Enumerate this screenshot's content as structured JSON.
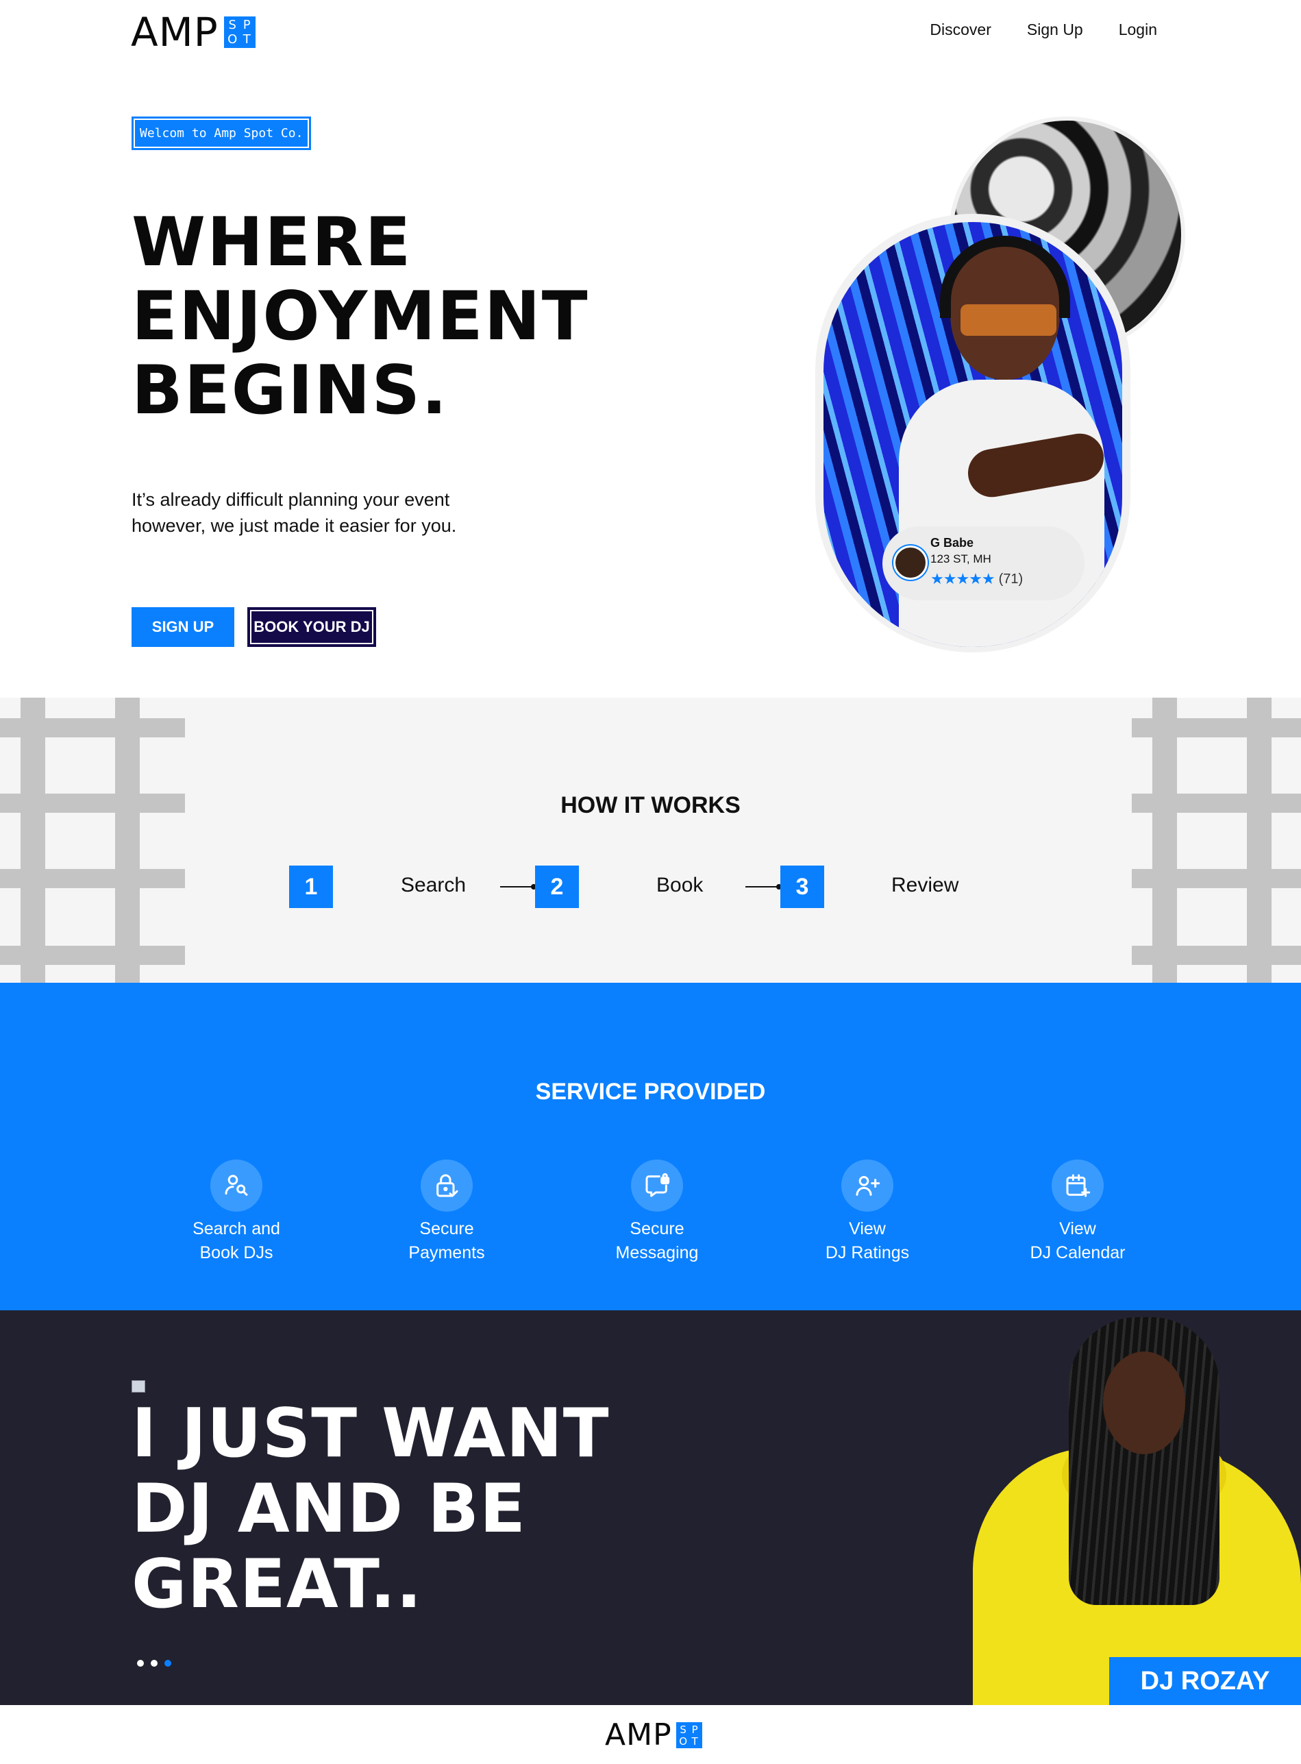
{
  "nav": {
    "logo": {
      "text": "AMP",
      "box": [
        "S",
        "P",
        "O",
        "T"
      ]
    },
    "links": [
      "Discover",
      "Sign Up",
      "Login"
    ]
  },
  "hero": {
    "badge": "Welcom to Amp Spot Co.",
    "title": [
      "WHERE",
      "ENJOYMENT",
      "BEGINS."
    ],
    "subtitle": "It’s already difficult planning your event however, we just made it easier for you.",
    "buttons": {
      "signup": "SIGN UP",
      "book": "BOOK YOUR DJ"
    },
    "profile": {
      "name": "G Babe",
      "location": "123 ST, MH",
      "stars": "★★★★★",
      "rating_count": "(71)",
      "rating": 5
    }
  },
  "how_it_works": {
    "title": "HOW IT WORKS",
    "steps": [
      {
        "num": "1",
        "label": "Search"
      },
      {
        "num": "2",
        "label": "Book"
      },
      {
        "num": "3",
        "label": "Review"
      }
    ]
  },
  "services": {
    "title": "SERVICE PROVIDED",
    "items": [
      {
        "line1": "Search and",
        "line2": "Book DJs",
        "icon": "user-search-icon"
      },
      {
        "line1": "Secure",
        "line2": "Payments",
        "icon": "lock-check-icon"
      },
      {
        "line1": "Secure",
        "line2": "Messaging",
        "icon": "message-lock-icon"
      },
      {
        "line1": "View",
        "line2": "DJ Ratings",
        "icon": "user-plus-icon"
      },
      {
        "line1": "View",
        "line2": "DJ Calendar",
        "icon": "calendar-plus-icon"
      }
    ]
  },
  "quote": {
    "title": [
      "I JUST WANT",
      "DJ AND BE",
      "GREAT.."
    ],
    "dj_name": "DJ ROZAY",
    "slide_count": 3,
    "active_slide": 3
  },
  "footer": {
    "logo": {
      "text": "AMP",
      "box": [
        "S",
        "P",
        "O",
        "T"
      ]
    }
  },
  "colors": {
    "accent": "#0a80ff",
    "dark_navy": "#140a4a",
    "quote_bg": "#22212f",
    "how_bg": "#f5f5f5"
  }
}
